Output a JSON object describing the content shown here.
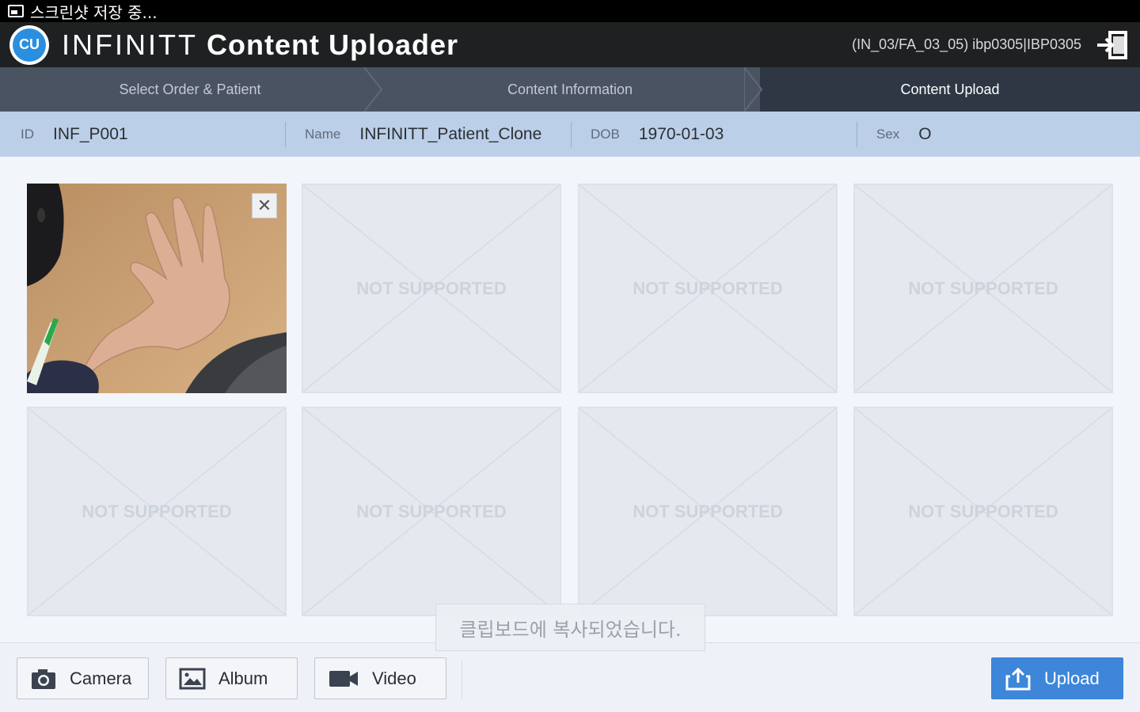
{
  "status_bar": {
    "text": "스크린샷 저장 중..."
  },
  "app": {
    "logo_text": "CU",
    "title_brand": "INFINITT",
    "title_rest": "Content Uploader",
    "user_info": "(IN_03/FA_03_05) ibp0305|IBP0305"
  },
  "steps": [
    {
      "label": "Select Order & Patient"
    },
    {
      "label": "Content Information"
    },
    {
      "label": "Content Upload"
    }
  ],
  "patient": {
    "id_label": "ID",
    "id_value": "INF_P001",
    "name_label": "Name",
    "name_value": "INFINITT_Patient_Clone",
    "dob_label": "DOB",
    "dob_value": "1970-01-03",
    "sex_label": "Sex",
    "sex_value": "O"
  },
  "tiles": {
    "not_supported": "NOT SUPPORTED",
    "remove_symbol": "✕"
  },
  "toast": "클립보드에 복사되었습니다.",
  "toolbar": {
    "camera_label": "Camera",
    "album_label": "Album",
    "video_label": "Video",
    "upload_label": "Upload"
  }
}
